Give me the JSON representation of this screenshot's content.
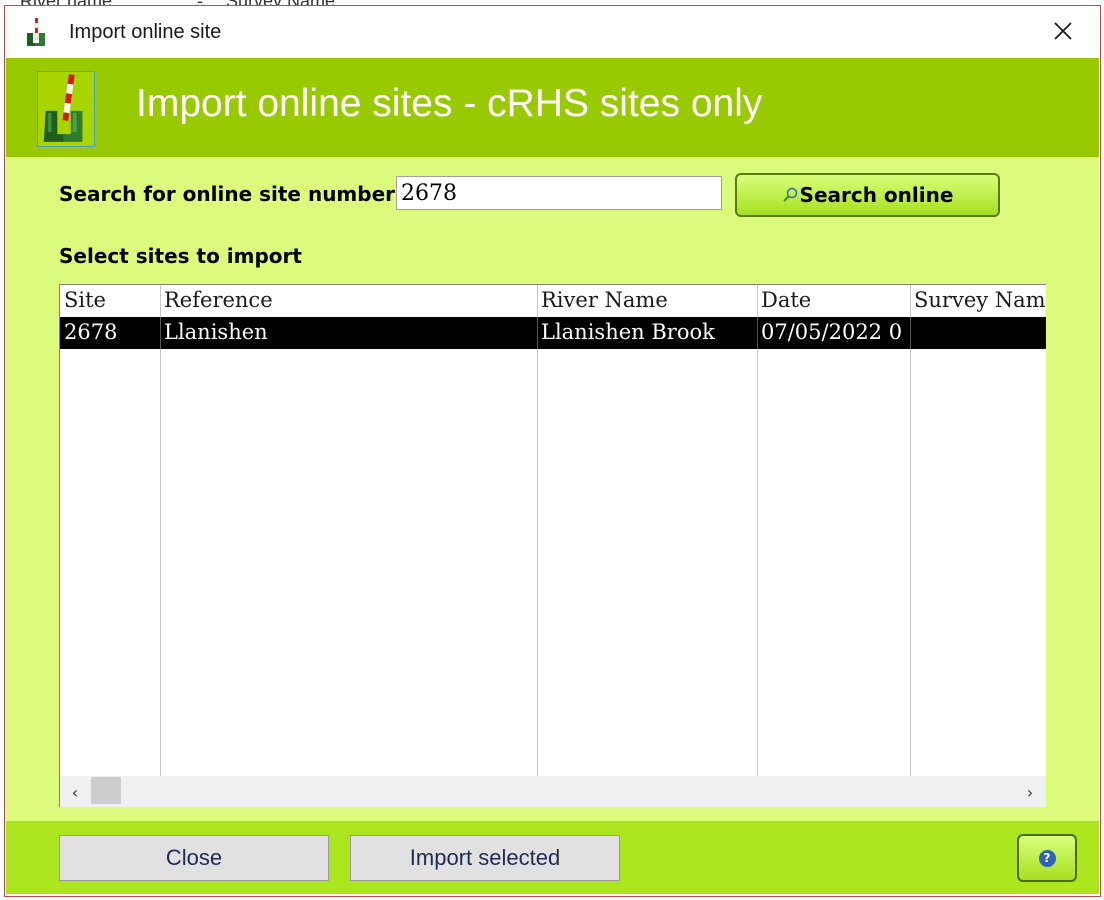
{
  "background": {
    "texts": [
      "River name",
      "-",
      "Survey Name"
    ]
  },
  "window": {
    "title": "Import online site",
    "app_icon": "survey-pole-boots-icon",
    "close_icon": "close-icon"
  },
  "header": {
    "title": "Import online sites - cRHS sites only",
    "icon": "survey-pole-boots-icon"
  },
  "search": {
    "label": "Search for online site number:",
    "value": "2678",
    "button_label": "Search online",
    "button_icon": "search-globe-icon"
  },
  "list": {
    "label": "Select sites to import",
    "columns": [
      "Site",
      "Reference",
      "River Name",
      "Date",
      "Survey Name"
    ],
    "rows": [
      [
        "2678",
        "Llanishen",
        "Llanishen Brook",
        "07/05/2022 0",
        ""
      ]
    ],
    "selected_row": 0,
    "scroll_left_icon": "chevron-left-icon",
    "scroll_right_icon": "chevron-right-icon"
  },
  "footer": {
    "close_label": "Close",
    "import_label": "Import selected",
    "help_icon": "help-icon",
    "help_glyph": "?"
  },
  "colors": {
    "header_band": "#99c900",
    "body_bg": "#dcfb7c",
    "footer_bg": "#abe61f",
    "button_green": "#a6e020",
    "window_border": "#c7474f"
  }
}
